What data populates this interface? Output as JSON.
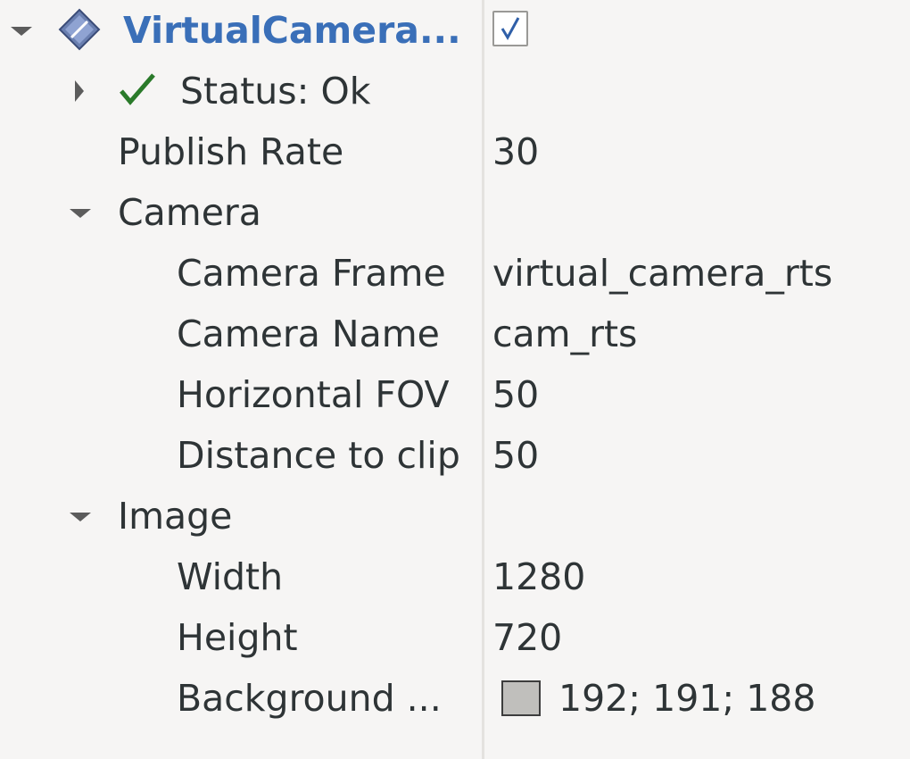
{
  "display": {
    "name": "VirtualCamera...",
    "enabled": true,
    "status": "Status: Ok",
    "icon": "diamond-icon"
  },
  "properties": {
    "publish_rate": {
      "label": "Publish Rate",
      "value": "30"
    },
    "camera": {
      "label": "Camera",
      "frame": {
        "label": "Camera Frame",
        "value": "virtual_camera_rts"
      },
      "name": {
        "label": "Camera Name",
        "value": "cam_rts"
      },
      "hfov": {
        "label": "Horizontal FOV",
        "value": "50"
      },
      "clip": {
        "label": "Distance to clip",
        "value": "50"
      }
    },
    "image": {
      "label": "Image",
      "width": {
        "label": "Width",
        "value": "1280"
      },
      "height": {
        "label": "Height",
        "value": "720"
      },
      "background": {
        "label": "Background ...",
        "value": "192; 191; 188",
        "color": "#c0bfbc"
      }
    }
  },
  "colors": {
    "title": "#3a6fb8",
    "check": "#2a7a2a"
  }
}
